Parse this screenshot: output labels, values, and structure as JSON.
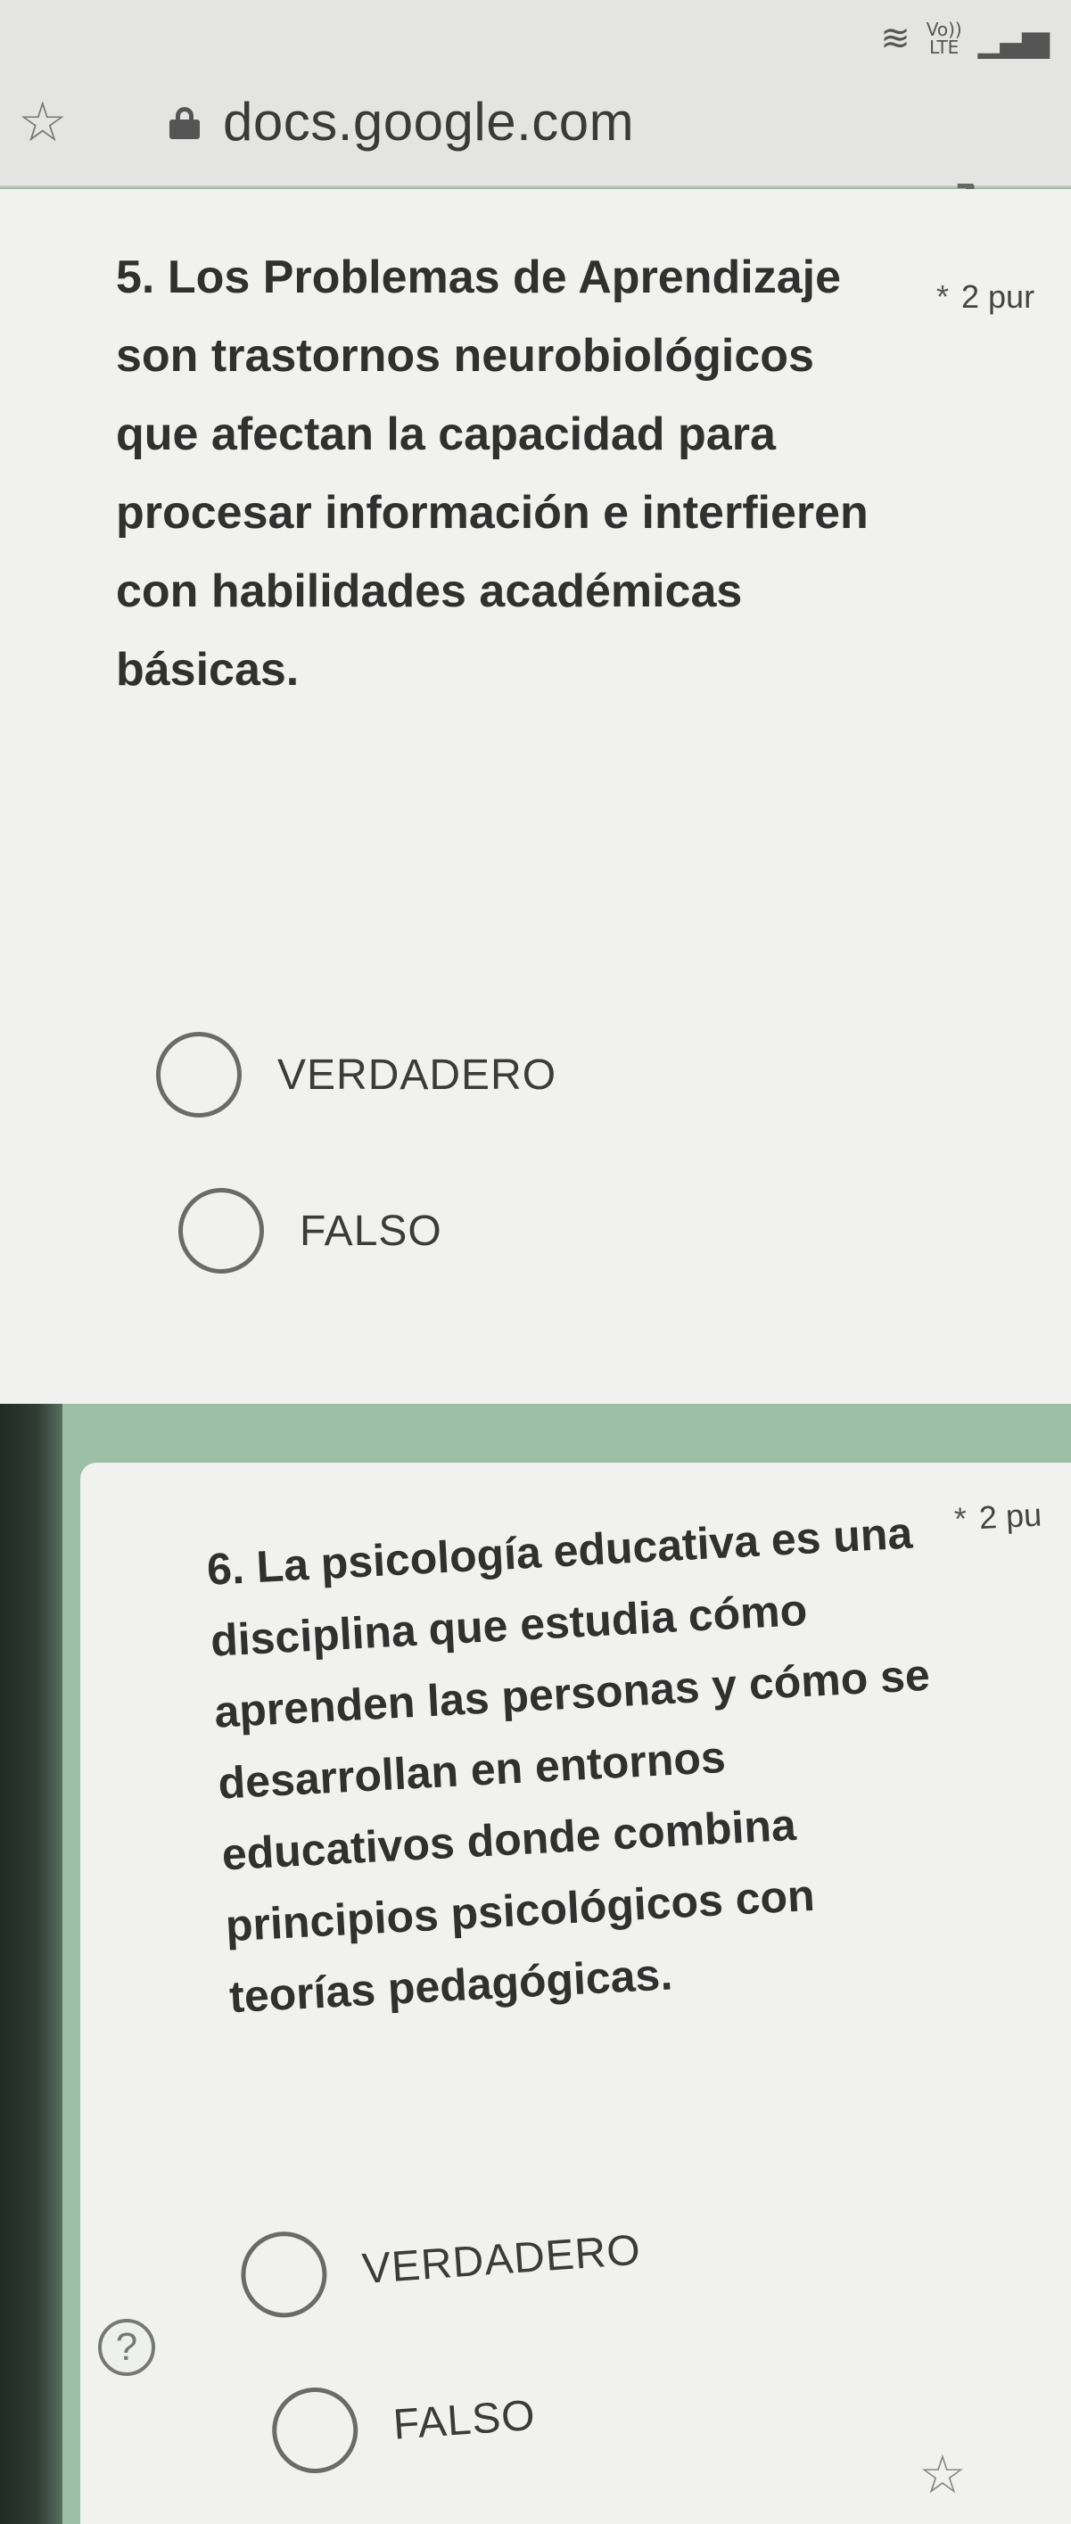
{
  "status_bar": {
    "lte_top": "Vo))",
    "lte_bottom": "LTE"
  },
  "browser": {
    "url": "docs.google.com"
  },
  "questions": [
    {
      "title": "5. Los Problemas de Aprendizaje son trastornos neurobiológicos que afectan la capacidad para procesar información e interfieren con habilidades académicas básicas.",
      "required_mark": "*",
      "points": "2 pur",
      "options": [
        "VERDADERO",
        "FALSO"
      ]
    },
    {
      "title": "6. La psicología educativa es una disciplina que estudia cómo aprenden las personas y cómo se desarrollan en entornos educativos donde combina principios psicológicos con teorías pedagógicas.",
      "required_mark": "*",
      "points": "2 pu",
      "options": [
        "VERDADERO",
        "FALSO"
      ]
    }
  ],
  "colors": {
    "accent": "#9cbfa6",
    "card": "#f1f1ef",
    "text": "#303030"
  },
  "icons": {
    "bookmark": "star-outline-icon",
    "lock": "lock-icon",
    "reload": "reload-icon",
    "help": "help-icon",
    "wifi": "wifi-icon",
    "signal": "signal-icon",
    "fab": "star-menu-icon"
  }
}
